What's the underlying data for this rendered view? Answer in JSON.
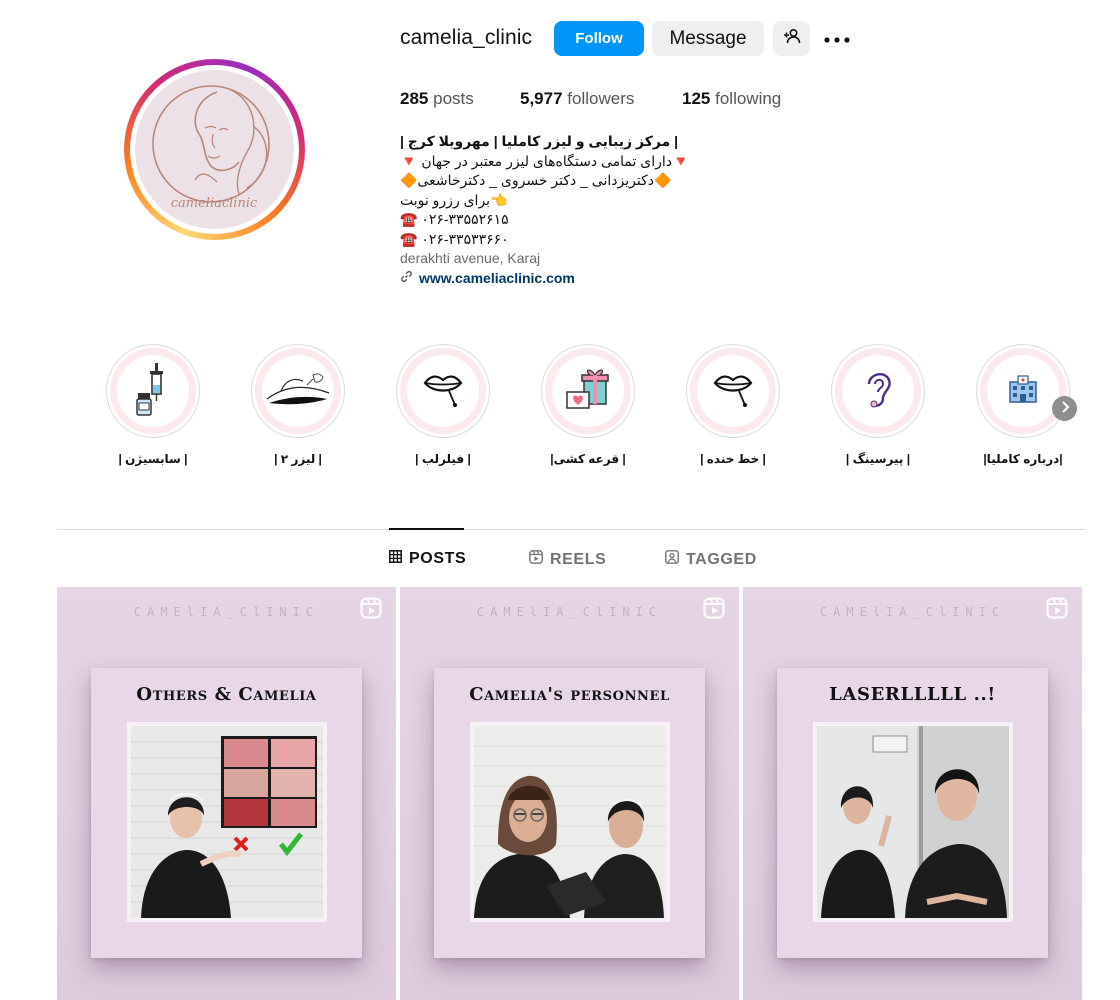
{
  "profile": {
    "username": "camelia_clinic",
    "avatar_text": "cameliaclinic",
    "follow_label": "Follow",
    "message_label": "Message",
    "stats": {
      "posts_count": "285",
      "posts_label": "posts",
      "followers_count": "5,977",
      "followers_label": "followers",
      "following_count": "125",
      "following_label": "following"
    },
    "bio": {
      "title": "| مرکز زیبایی و لیزر کاملیا | مهرویلا کرج |",
      "line1": "🔻دارای تمامی دستگاه‌های لیزر معتبر در جهان 🔻",
      "line2": "🔶دکتریزدانی _ دکتر خسروی _ دکترخاشعی🔶",
      "line3": "👈برای رزرو نوبت",
      "phone1": "☎️ ۰۲۶-۳۳۵۵۲۶۱۵",
      "phone2": "☎️ ۰۲۶-۳۳۵۳۳۶۶۰",
      "address": "derakhti avenue, Karaj",
      "website": "www.cameliaclinic.com"
    }
  },
  "highlights": [
    {
      "label": "| سابسیژن |",
      "icon": "syringe-icon"
    },
    {
      "label": "| لیزر ۲ |",
      "icon": "laser-legs-icon"
    },
    {
      "label": "| فیلرلب |",
      "icon": "lips-icon"
    },
    {
      "label": "| قرعه کشی|",
      "icon": "gift-icon"
    },
    {
      "label": "| خط خنده |",
      "icon": "lips-icon"
    },
    {
      "label": "| پیرسینگ |",
      "icon": "ear-icon"
    },
    {
      "label": "|درباره کاملیا|",
      "icon": "building-icon"
    }
  ],
  "tabs": [
    {
      "label": "POSTS",
      "icon": "grid-icon",
      "active": true
    },
    {
      "label": "REELS",
      "icon": "reels-icon",
      "active": false
    },
    {
      "label": "TAGGED",
      "icon": "tagged-icon",
      "active": false
    }
  ],
  "posts": [
    {
      "watermark": "CAMElIA_ClINIC",
      "headline": "Others & Camelia",
      "type": "reel"
    },
    {
      "watermark": "CAMElIA_ClINIC",
      "headline": "Camelia's personnel",
      "type": "reel"
    },
    {
      "watermark": "CAMElIA_ClINIC",
      "headline": "LASERLLLLL ..!",
      "type": "reel"
    }
  ],
  "colors": {
    "accent": "#0095f6",
    "post_bg": "#e5d5e5",
    "highlight_ring": "#fbe9ec"
  }
}
